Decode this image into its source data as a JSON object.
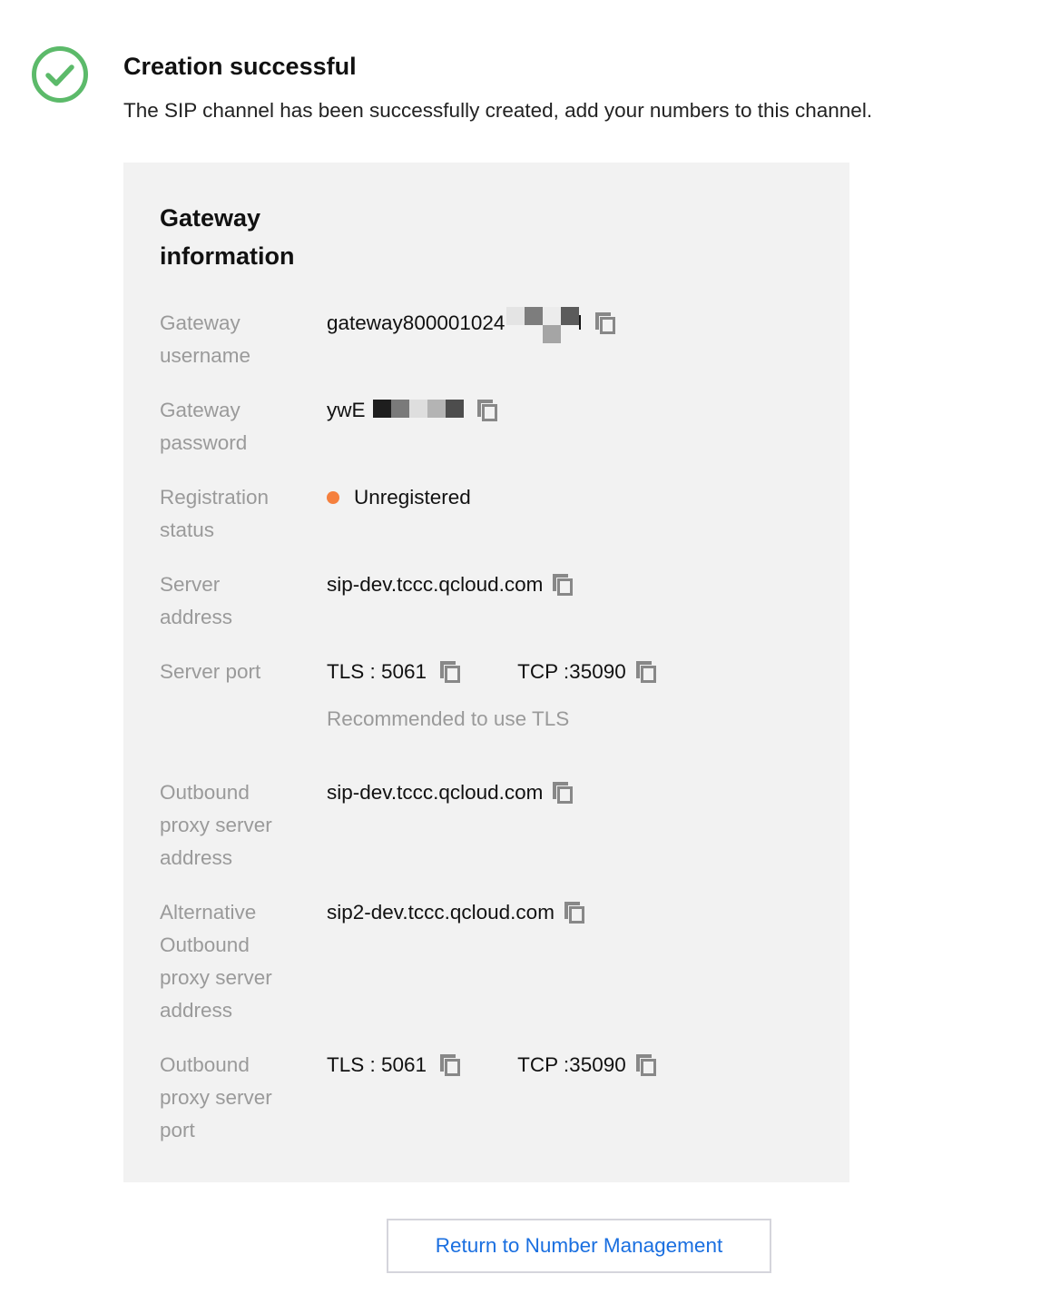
{
  "header": {
    "title": "Creation successful",
    "description": "The SIP channel has been successfully created, add your numbers to this channel."
  },
  "colors": {
    "success_green": "#5cba6a",
    "status_orange": "#f5803e",
    "link_blue": "#1a6fe0",
    "panel_bg": "#f2f2f2"
  },
  "panel": {
    "title": "Gateway information",
    "rows": {
      "username": {
        "label": "Gateway username",
        "value_prefix": "gateway800001024",
        "value_suffix": "l"
      },
      "password": {
        "label": "Gateway password",
        "value_prefix": "ywE"
      },
      "registration": {
        "label": "Registration status",
        "value": "Unregistered"
      },
      "server_address": {
        "label": "Server address",
        "value": "sip-dev.tccc.qcloud.com"
      },
      "server_port": {
        "label": "Server port",
        "tls": "TLS : 5061",
        "tcp": "TCP :35090",
        "hint": "Recommended to use TLS"
      },
      "outbound_proxy": {
        "label": "Outbound proxy server address",
        "value": "sip-dev.tccc.qcloud.com"
      },
      "alt_outbound_proxy": {
        "label": "Alternative Outbound proxy server address",
        "value": "sip2-dev.tccc.qcloud.com"
      },
      "outbound_proxy_port": {
        "label": "Outbound proxy server port",
        "tls": "TLS : 5061",
        "tcp": "TCP :35090"
      }
    }
  },
  "actions": {
    "return_label": "Return to Number Management"
  },
  "icons": {
    "success": "check-circle-icon",
    "copy": "copy-icon"
  }
}
